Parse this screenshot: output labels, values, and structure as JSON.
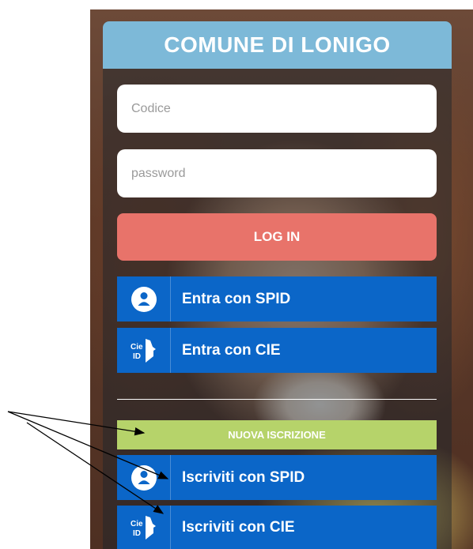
{
  "header": {
    "title": "COMUNE DI LONIGO"
  },
  "login_form": {
    "code_placeholder": "Codice",
    "password_placeholder": "password",
    "login_label": "LOG IN"
  },
  "auth": {
    "spid_label": "Entra con SPID",
    "cie_label": "Entra con CIE"
  },
  "registration": {
    "new_label": "NUOVA ISCRIZIONE",
    "spid_label": "Iscriviti con SPID",
    "cie_label": "Iscriviti con CIE"
  },
  "icons": {
    "spid": "spid-user-icon",
    "cie": "cie-id-icon",
    "cie_text_top": "Cie",
    "cie_text_bottom": "ID"
  },
  "colors": {
    "header": "#7db9d8",
    "login": "#e8736a",
    "blue": "#0b66c8",
    "green": "#b6d36a"
  }
}
